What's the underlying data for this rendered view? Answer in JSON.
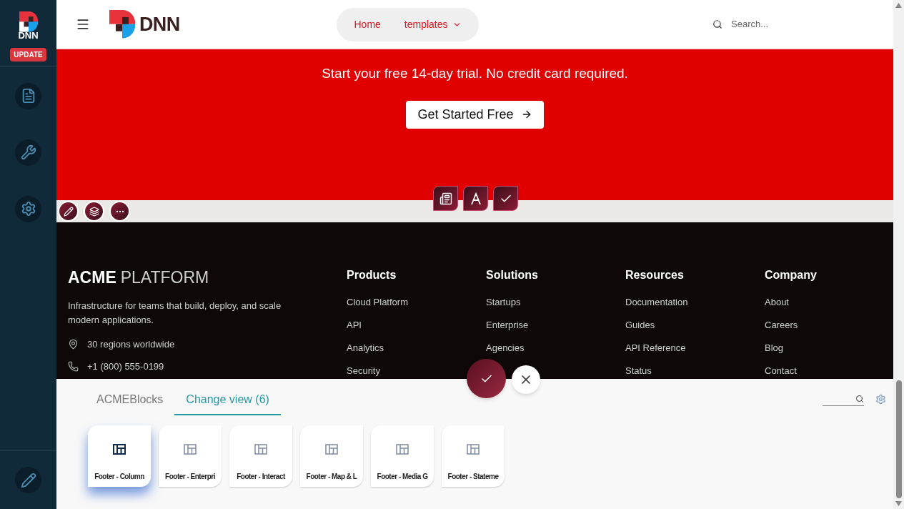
{
  "sidebar": {
    "brand": "DNN",
    "badge": "UPDATE",
    "items": [
      {
        "kind": "content"
      },
      {
        "kind": "tools"
      },
      {
        "kind": "settings"
      }
    ],
    "footer_item": {
      "kind": "edit"
    }
  },
  "header": {
    "brand": "DNN",
    "nav": [
      {
        "label": "Home",
        "dropdown": false
      },
      {
        "label": "templates",
        "dropdown": true
      }
    ],
    "search": {
      "placeholder": "Search..."
    }
  },
  "cta": {
    "text": "Start your free 14-day trial. No credit card required.",
    "button": "Get Started Free"
  },
  "module_actions": [
    {
      "kind": "edit"
    },
    {
      "kind": "layers"
    },
    {
      "kind": "more"
    }
  ],
  "module_toolbar": [
    {
      "kind": "content"
    },
    {
      "kind": "text"
    },
    {
      "kind": "check"
    }
  ],
  "footer": {
    "brand_bold": "ACME",
    "brand_light": "PLATFORM",
    "description": "Infrastructure for teams that build, deploy, and scale modern applications.",
    "contacts": [
      {
        "kind": "location",
        "text": "30 regions worldwide"
      },
      {
        "kind": "phone",
        "text": "+1 (800) 555-0199"
      }
    ],
    "columns": [
      {
        "title": "Products",
        "links": [
          "Cloud Platform",
          "API",
          "Analytics",
          "Security"
        ]
      },
      {
        "title": "Solutions",
        "links": [
          "Startups",
          "Enterprise",
          "Agencies"
        ]
      },
      {
        "title": "Resources",
        "links": [
          "Documentation",
          "Guides",
          "API Reference",
          "Status"
        ]
      },
      {
        "title": "Company",
        "links": [
          "About",
          "Careers",
          "Blog",
          "Contact"
        ]
      }
    ]
  },
  "panel": {
    "tabs": [
      {
        "label": "ACMEBlocks",
        "selected": false
      },
      {
        "label": "Change view (6)",
        "selected": true
      }
    ],
    "cards": [
      {
        "label": "Footer - Column",
        "selected": true
      },
      {
        "label": "Footer - Enterpri",
        "selected": false
      },
      {
        "label": "Footer - Interact",
        "selected": false
      },
      {
        "label": "Footer - Map & L",
        "selected": false
      },
      {
        "label": "Footer - Media G",
        "selected": false
      },
      {
        "label": "Footer - Stateme",
        "selected": false
      }
    ]
  }
}
